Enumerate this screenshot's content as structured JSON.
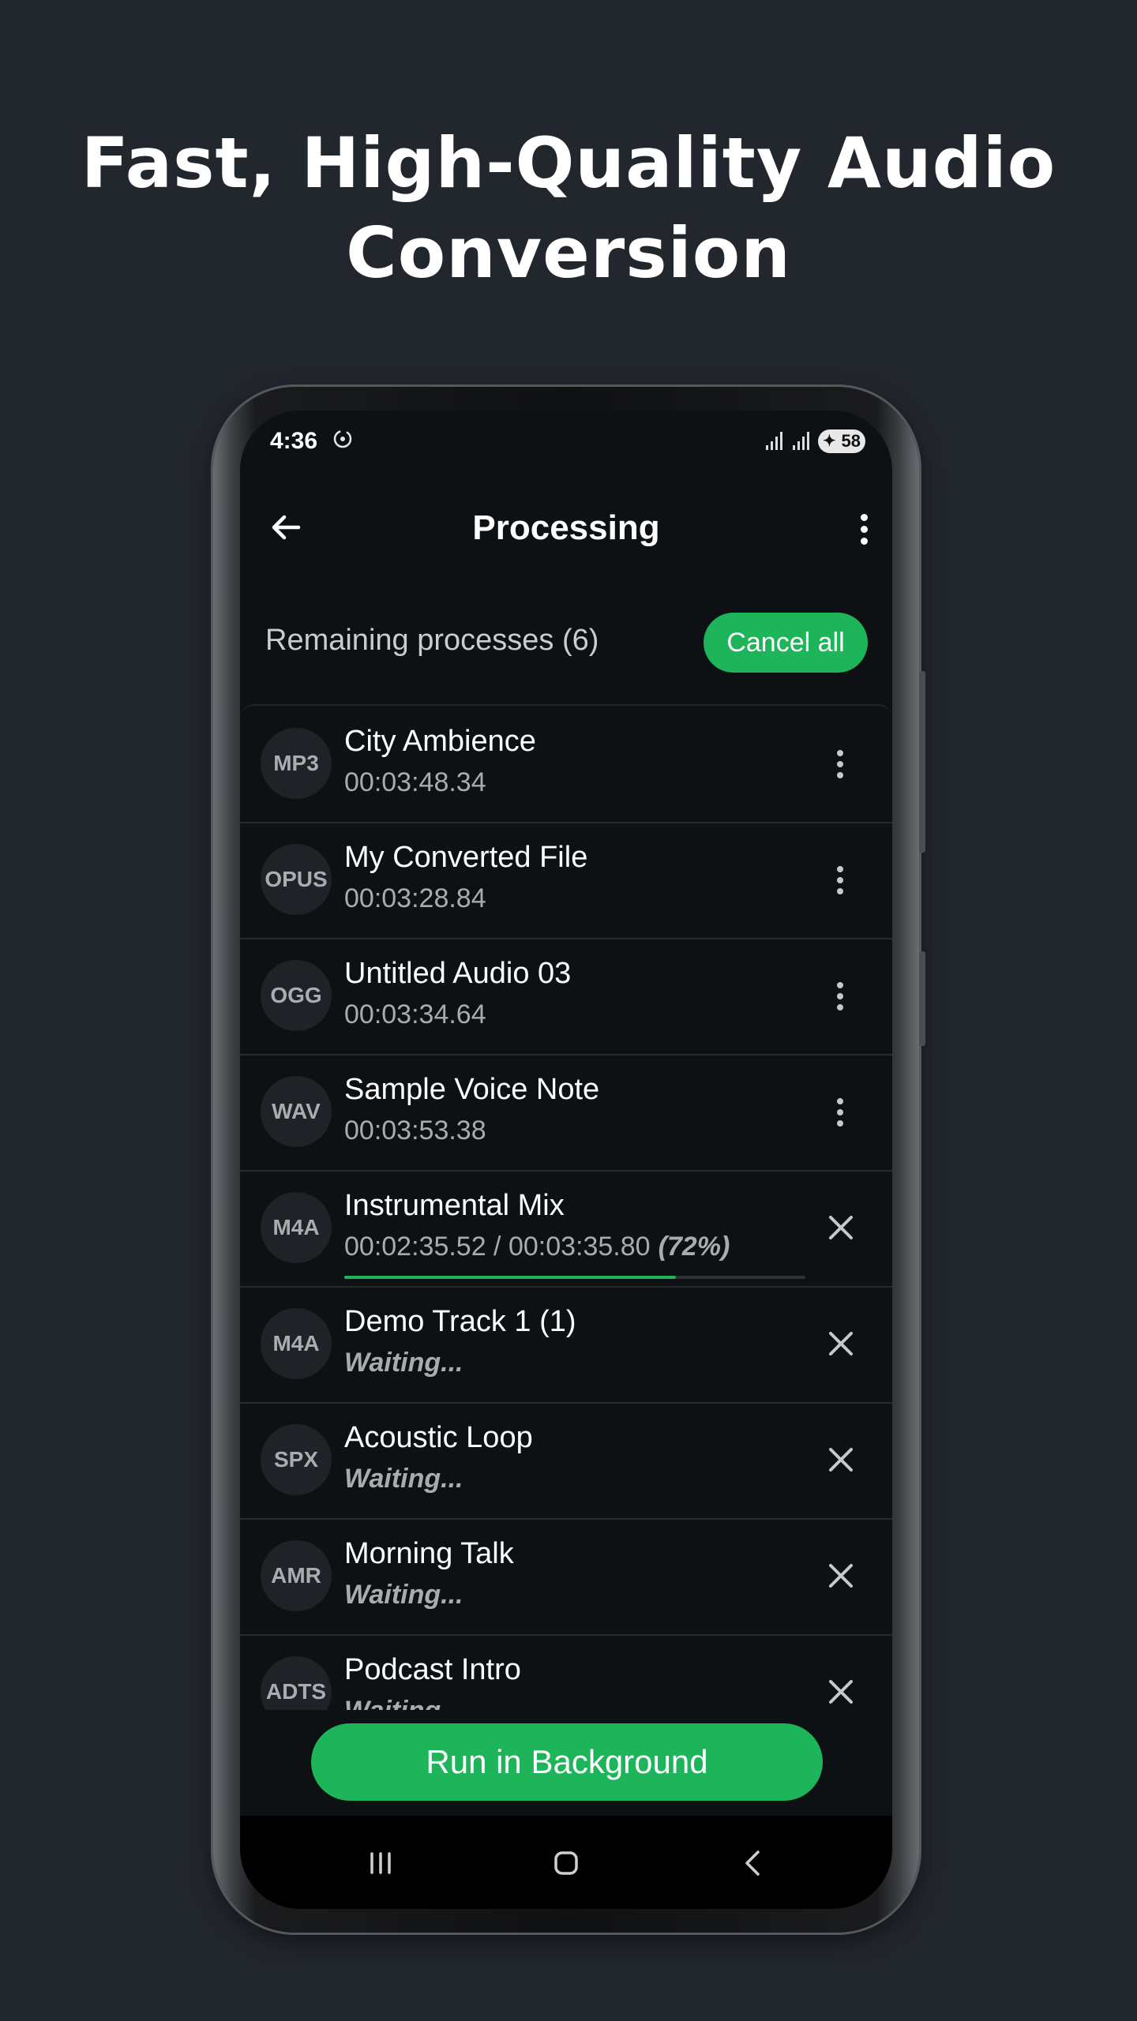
{
  "headline": {
    "line1": "Fast, High-Quality Audio",
    "line2": "Conversion"
  },
  "status_bar": {
    "time": "4:36",
    "battery": "58",
    "icons": [
      "sync-icon",
      "signal-icon",
      "signal-icon",
      "battery-icon"
    ]
  },
  "app_bar": {
    "title": "Processing",
    "back_icon": "arrow-left-icon",
    "menu_icon": "more-vert-icon"
  },
  "summary": {
    "remaining_label": "Remaining processes (6)",
    "cancel_all_label": "Cancel all"
  },
  "items": [
    {
      "format": "MP3",
      "name": "City Ambience",
      "detail": "00:03:48.34",
      "action": "more"
    },
    {
      "format": "OPUS",
      "name": "My Converted File",
      "detail": "00:03:28.84",
      "action": "more"
    },
    {
      "format": "OGG",
      "name": "Untitled Audio 03",
      "detail": "00:03:34.64",
      "action": "more"
    },
    {
      "format": "WAV",
      "name": "Sample Voice Note",
      "detail": "00:03:53.38",
      "action": "more"
    },
    {
      "format": "M4A",
      "name": "Instrumental Mix",
      "detail": "00:02:35.52 / 00:03:35.80",
      "percent_label": "(72%)",
      "progress": 0.72,
      "action": "cancel"
    },
    {
      "format": "M4A",
      "name": "Demo Track 1 (1)",
      "detail": "Waiting...",
      "action": "cancel"
    },
    {
      "format": "SPX",
      "name": "Acoustic Loop",
      "detail": "Waiting...",
      "action": "cancel"
    },
    {
      "format": "AMR",
      "name": "Morning Talk",
      "detail": "Waiting...",
      "action": "cancel"
    },
    {
      "format": "ADTS",
      "name": "Podcast Intro",
      "detail": "Waiting...",
      "action": "cancel"
    }
  ],
  "footer": {
    "run_background_label": "Run in Background"
  },
  "nav_bar": {
    "icons": [
      "recents-icon",
      "home-icon",
      "back-icon"
    ]
  },
  "colors": {
    "accent": "#1db45a",
    "page_background": "#22262d",
    "screen_background": "#0d1114"
  }
}
